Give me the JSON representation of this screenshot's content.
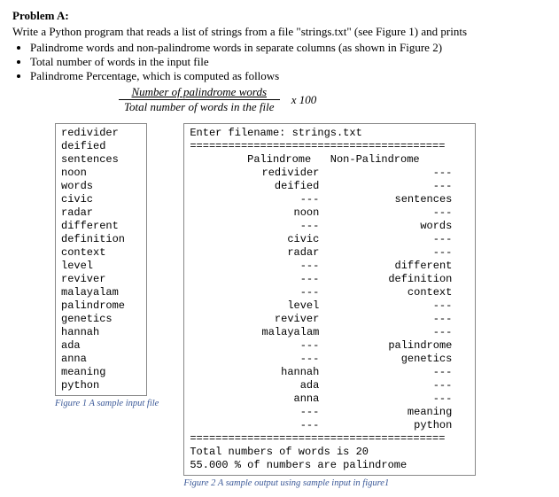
{
  "title": "Problem A:",
  "instr": "Write a Python program that reads a list of strings from a file \"strings.txt\" (see Figure 1) and prints",
  "bullets": [
    "Palindrome words and non-palindrome words in separate columns (as shown in Figure 2)",
    "Total number of words in the input file",
    "Palindrome Percentage, which is computed as follows"
  ],
  "formula": {
    "numerator": "Number of palindrome words",
    "denominator": "Total number of words in the file",
    "suffix": "x  100"
  },
  "fig1": {
    "words": [
      "redivider",
      "deified",
      "sentences",
      "noon",
      "words",
      "civic",
      "radar",
      "different",
      "definition",
      "context",
      "level",
      "reviver",
      "malayalam",
      "palindrome",
      "genetics",
      "hannah",
      "ada",
      "anna",
      "meaning",
      "python"
    ],
    "caption": "Figure 1 A sample input file"
  },
  "fig2": {
    "prompt": "Enter filename: strings.txt",
    "sep": "========================================",
    "hdr_pal": "Palindrome",
    "hdr_non": "Non-Palindrome",
    "rows": [
      {
        "p": "redivider",
        "n": "---"
      },
      {
        "p": "deified",
        "n": "---"
      },
      {
        "p": "---",
        "n": "sentences"
      },
      {
        "p": "noon",
        "n": "---"
      },
      {
        "p": "---",
        "n": "words"
      },
      {
        "p": "civic",
        "n": "---"
      },
      {
        "p": "radar",
        "n": "---"
      },
      {
        "p": "---",
        "n": "different"
      },
      {
        "p": "---",
        "n": "definition"
      },
      {
        "p": "---",
        "n": "context"
      },
      {
        "p": "level",
        "n": "---"
      },
      {
        "p": "reviver",
        "n": "---"
      },
      {
        "p": "malayalam",
        "n": "---"
      },
      {
        "p": "---",
        "n": "palindrome"
      },
      {
        "p": "---",
        "n": "genetics"
      },
      {
        "p": "hannah",
        "n": "---"
      },
      {
        "p": "ada",
        "n": "---"
      },
      {
        "p": "anna",
        "n": "---"
      },
      {
        "p": "---",
        "n": "meaning"
      },
      {
        "p": "---",
        "n": "python"
      }
    ],
    "total_line": "Total numbers of words is  20",
    "pct_line": "55.000 % of numbers are palindrome",
    "caption": "Figure 2 A sample output using sample input in figure1"
  }
}
